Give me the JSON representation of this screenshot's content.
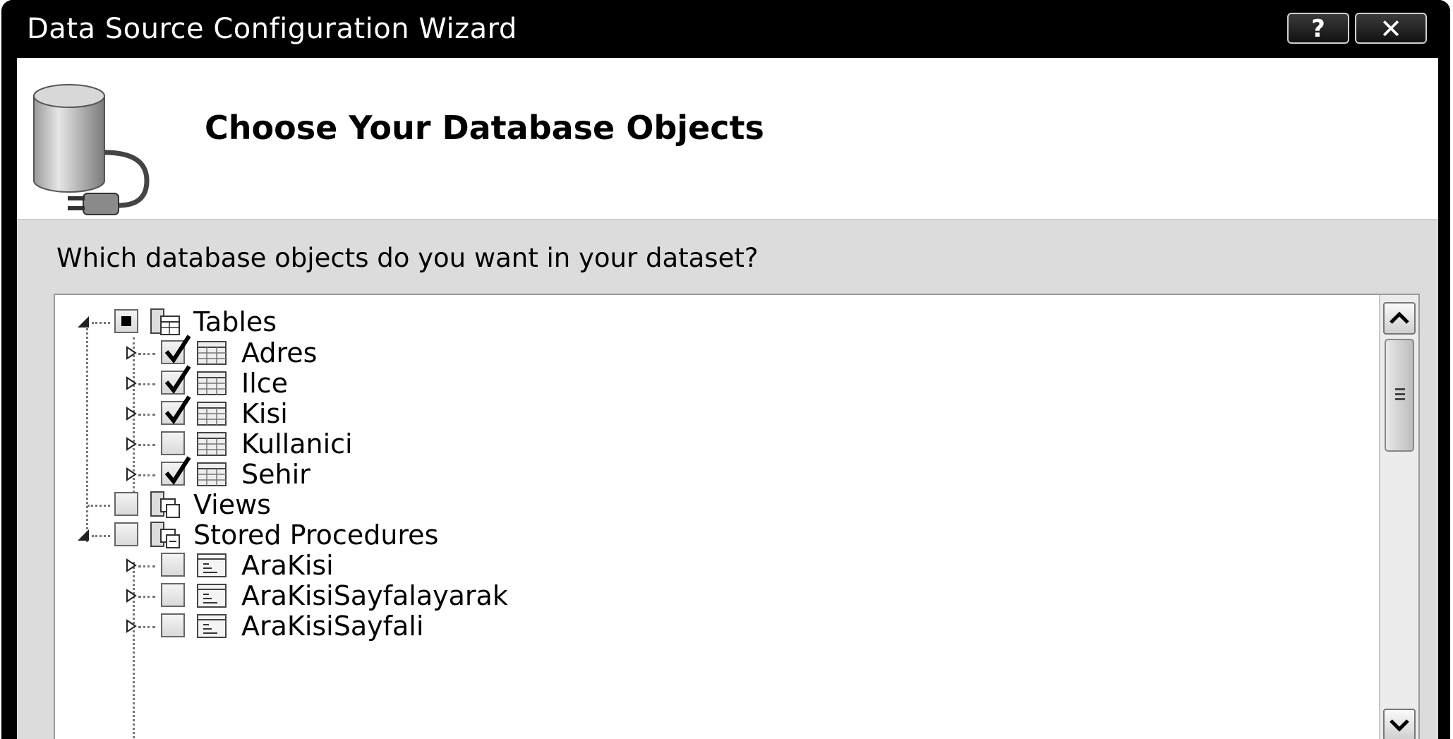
{
  "window": {
    "title": "Data Source Configuration Wizard",
    "help_label": "?",
    "close_label": "✕"
  },
  "header": {
    "title": "Choose Your Database Objects",
    "icon": "database-plug-icon"
  },
  "question": "Which database objects do you want in your dataset?",
  "tree": {
    "groups": [
      {
        "label": "Tables",
        "expanded": true,
        "state": "partial",
        "icon": "tables-folder-icon",
        "children": [
          {
            "label": "Adres",
            "checked": true,
            "icon": "table-icon"
          },
          {
            "label": "Ilce",
            "checked": true,
            "icon": "table-icon"
          },
          {
            "label": "Kisi",
            "checked": true,
            "icon": "table-icon"
          },
          {
            "label": "Kullanici",
            "checked": false,
            "icon": "table-icon"
          },
          {
            "label": "Sehir",
            "checked": true,
            "icon": "table-icon"
          }
        ]
      },
      {
        "label": "Views",
        "expanded": false,
        "state": "unchecked",
        "icon": "views-folder-icon",
        "children": []
      },
      {
        "label": "Stored Procedures",
        "expanded": true,
        "state": "unchecked",
        "icon": "procedures-folder-icon",
        "children": [
          {
            "label": "AraKisi",
            "checked": false,
            "icon": "procedure-icon"
          },
          {
            "label": "AraKisiSayfalayarak",
            "checked": false,
            "icon": "procedure-icon"
          },
          {
            "label": "AraKisiSayfali",
            "checked": false,
            "icon": "procedure-icon"
          }
        ]
      }
    ]
  },
  "colors": {
    "titlebar": "#000000",
    "client": "#dcdcdc",
    "header": "#ffffff"
  }
}
